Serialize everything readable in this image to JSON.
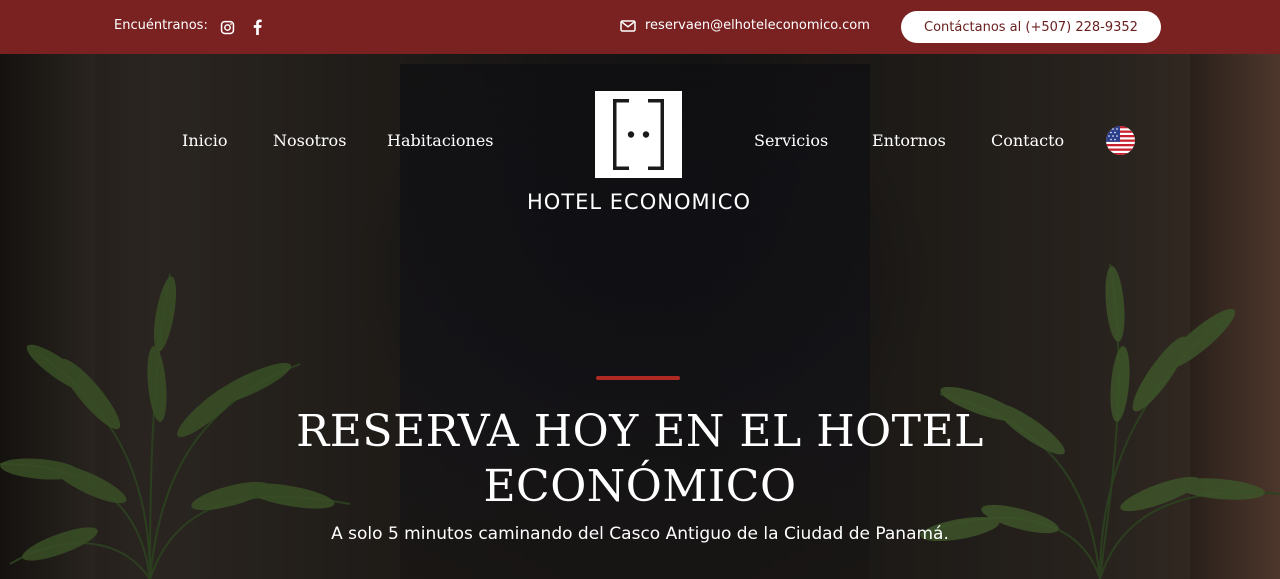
{
  "topbar": {
    "find_us_label": "Encuéntranos:",
    "email": "reservaen@elhoteleconomico.com",
    "contact_button": "Contáctanos al (+507) 228-9352",
    "background_color": "#7a2222",
    "icons": [
      "instagram-icon",
      "facebook-icon",
      "mail-icon"
    ]
  },
  "nav": {
    "left": [
      "Inicio",
      "Nosotros",
      "Habitaciones"
    ],
    "right": [
      "Servicios",
      "Entornos",
      "Contacto"
    ],
    "language_icon": "us-flag-icon"
  },
  "logo": {
    "text": "HOTEL ECONOMICO"
  },
  "hero": {
    "headline_line1": "RESERVA HOY EN EL HOTEL",
    "headline_line2": "ECONÓMICO",
    "subtitle": "A solo 5 minutos caminando del Casco Antiguo de la Ciudad de Panamá.",
    "accent_color": "#b02a24"
  }
}
